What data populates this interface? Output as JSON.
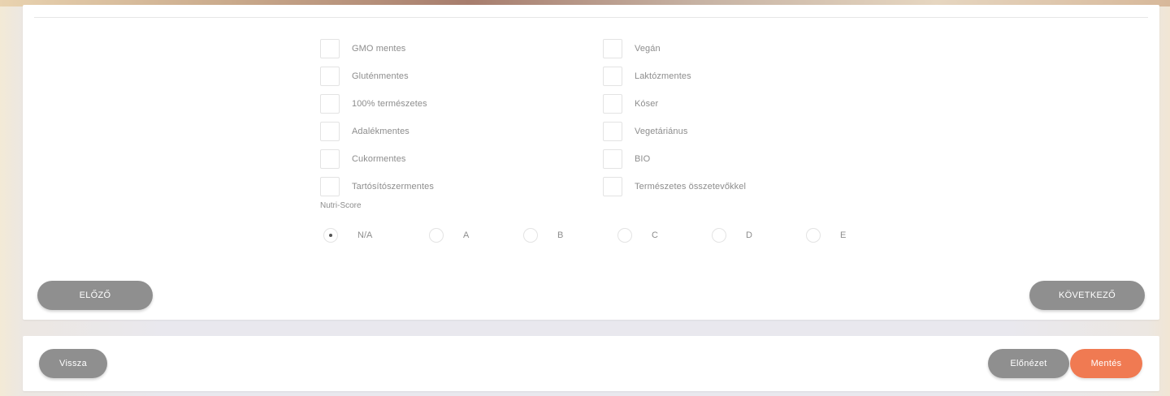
{
  "checkboxes_left": [
    {
      "label": "GMO mentes",
      "checked": false
    },
    {
      "label": "Gluténmentes",
      "checked": false
    },
    {
      "label": "100% természetes",
      "checked": false
    },
    {
      "label": "Adalékmentes",
      "checked": false
    },
    {
      "label": "Cukormentes",
      "checked": false
    },
    {
      "label": "Tartósítószermentes",
      "checked": false
    }
  ],
  "checkboxes_right": [
    {
      "label": "Vegán",
      "checked": false
    },
    {
      "label": "Laktózmentes",
      "checked": false
    },
    {
      "label": "Kóser",
      "checked": false
    },
    {
      "label": "Vegetáriánus",
      "checked": false
    },
    {
      "label": "BIO",
      "checked": false
    },
    {
      "label": "Természetes összetevőkkel",
      "checked": false
    }
  ],
  "nutri_score": {
    "label": "Nutri-Score",
    "options": [
      "N/A",
      "A",
      "B",
      "C",
      "D",
      "E"
    ],
    "selected": "N/A"
  },
  "navigation": {
    "prev_label": "ELŐZŐ",
    "next_label": "KÖVETKEZŐ"
  },
  "footer": {
    "back_label": "Vissza",
    "preview_label": "Előnézet",
    "save_label": "Mentés"
  },
  "colors": {
    "gray_button": "#8f8f8f",
    "save_button": "#f07a52"
  }
}
